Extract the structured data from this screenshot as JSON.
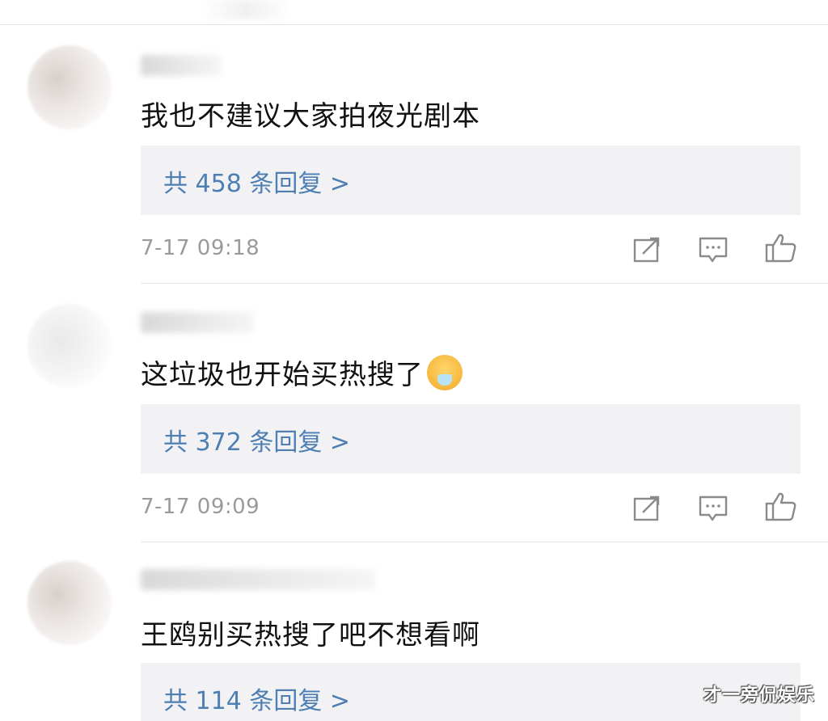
{
  "comments": [
    {
      "text": "我也不建议大家拍夜光剧本",
      "reply_link": "共 458 条回复 >",
      "timestamp": "7-17 09:18"
    },
    {
      "text": "这垃圾也开始买热搜了",
      "emoji": "vomit-emoji",
      "reply_link": "共 372 条回复 >",
      "timestamp": "7-17 09:09"
    },
    {
      "text": "王鸥别买热搜了吧不想看啊",
      "reply_link": "共 114 条回复 >"
    }
  ],
  "icons": {
    "share": "share-icon",
    "comment": "comment-icon",
    "like": "thumbs-up-icon"
  },
  "colors": {
    "link": "#4e7fb3",
    "timestamp": "#9a9a9a",
    "reply_bg": "#f2f2f4",
    "icon": "#8a8a8a"
  },
  "watermark": "才一旁侃娱乐"
}
